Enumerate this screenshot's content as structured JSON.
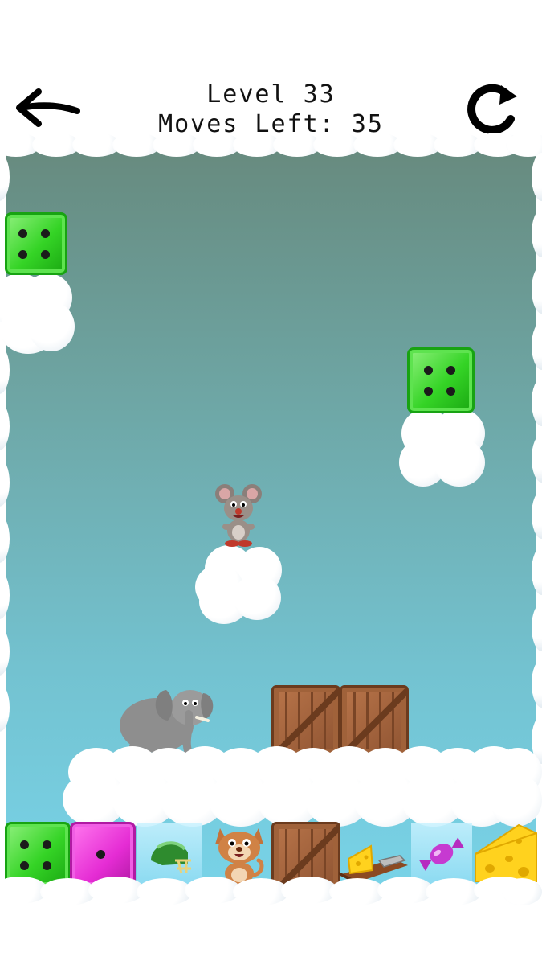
{
  "header": {
    "level_label": "Level 33",
    "moves_label": "Moves Left: 35"
  },
  "colors": {
    "sky_top": "#678a7e",
    "sky_bottom": "#78d3e8",
    "green_block": "#35d426",
    "magenta_block": "#e52cd4",
    "crate": "#a0623a"
  },
  "icons": {
    "back": "arrow-left-icon",
    "restart": "restart-icon"
  },
  "sprites": [
    "green-die-block",
    "mouse",
    "elephant",
    "wooden-crate",
    "magenta-die-block",
    "football-helmet",
    "cat",
    "mousetrap-with-cheese",
    "candy",
    "cheese-wedge"
  ]
}
